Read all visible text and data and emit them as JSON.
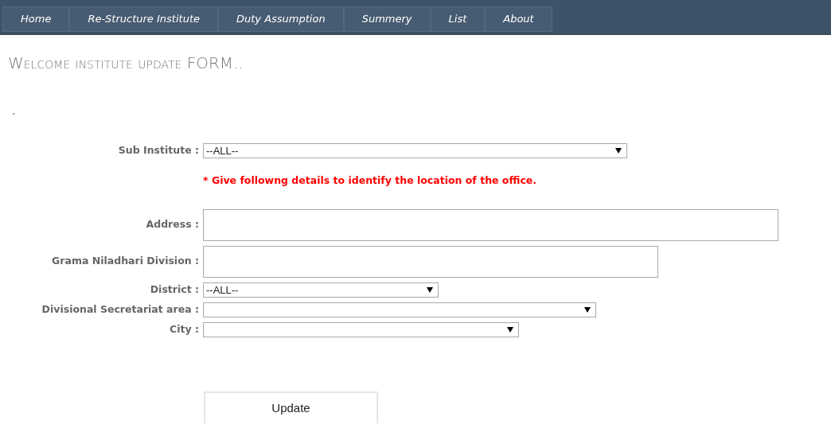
{
  "nav": [
    {
      "label": "Home",
      "selected": false
    },
    {
      "label": "Re-Structure Institute",
      "selected": false
    },
    {
      "label": "Duty Assumption",
      "selected": false
    },
    {
      "label": "Summery",
      "selected": false
    },
    {
      "label": "List",
      "selected": false
    },
    {
      "label": "About",
      "selected": false
    }
  ],
  "title": "Welcome institute update FORM..",
  "dot": ".",
  "form": [
    {
      "kind": "select",
      "label": "Sub Institute :",
      "value": "--ALL--"
    },
    {
      "kind": "note",
      "text": "* Give followng details to identify the location of the office."
    },
    {
      "kind": "input",
      "label": "Address :"
    },
    {
      "kind": "input",
      "label": "Grama Niladhari Division :"
    },
    {
      "kind": "select",
      "label": "District :",
      "value": "--ALL--"
    },
    {
      "kind": "select",
      "label": "Divisional Secretariat area :"
    },
    {
      "kind": "select",
      "label": "City :"
    }
  ],
  "submit": "Update"
}
